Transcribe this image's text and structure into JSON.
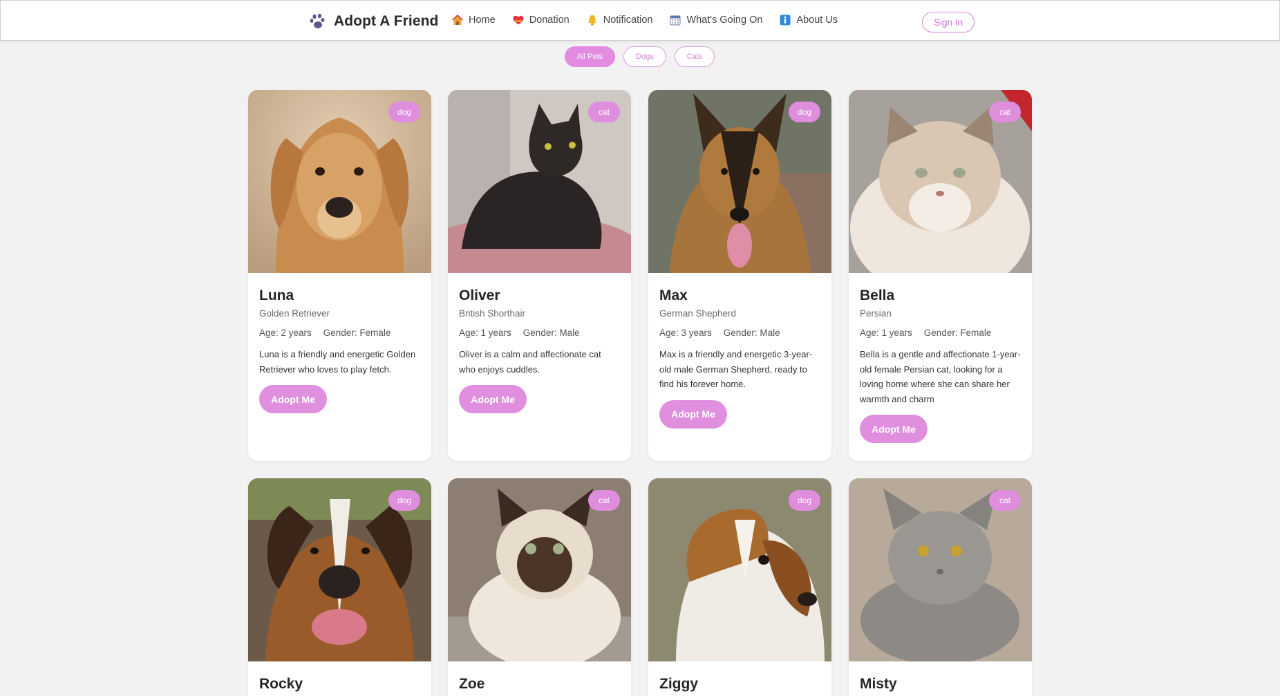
{
  "header": {
    "brand": "Adopt A Friend",
    "nav": [
      {
        "label": "Home",
        "icon": "house-icon"
      },
      {
        "label": "Donation",
        "icon": "heart-icon"
      },
      {
        "label": "Notification",
        "icon": "bell-icon"
      },
      {
        "label": "What's Going On",
        "icon": "calendar-icon"
      },
      {
        "label": "About Us",
        "icon": "info-icon"
      }
    ],
    "signin": "Sign In"
  },
  "filters": [
    "All Pets",
    "Dogs",
    "Cats"
  ],
  "colors": {
    "accent": "#e08fdf",
    "background": "#f2f2f3"
  },
  "pets": [
    {
      "name": "Luna",
      "type": "dog",
      "breed": "Golden Retriever",
      "age": "Age: 2 years",
      "gender": "Gender: Female",
      "description": "Luna is a friendly and energetic Golden Retriever who loves to play fetch.",
      "button": "Adopt Me"
    },
    {
      "name": "Oliver",
      "type": "cat",
      "breed": "British Shorthair",
      "age": "Age: 1 years",
      "gender": "Gender: Male",
      "description": "Oliver is a calm and affectionate cat who enjoys cuddles.",
      "button": "Adopt Me"
    },
    {
      "name": "Max",
      "type": "dog",
      "breed": "German Shepherd",
      "age": "Age: 3 years",
      "gender": "Gender: Male",
      "description": "Max is a friendly and energetic 3-year-old male German Shepherd, ready to find his forever home.",
      "button": "Adopt Me"
    },
    {
      "name": "Bella",
      "type": "cat",
      "breed": "Persian",
      "age": "Age: 1 years",
      "gender": "Gender: Female",
      "description": "Bella is a gentle and affectionate 1-year-old female Persian cat, looking for a loving home where she can share her warmth and charm",
      "button": "Adopt Me"
    },
    {
      "name": "Rocky",
      "type": "dog"
    },
    {
      "name": "Zoe",
      "type": "cat"
    },
    {
      "name": "Ziggy",
      "type": "dog"
    },
    {
      "name": "Misty",
      "type": "cat"
    }
  ]
}
